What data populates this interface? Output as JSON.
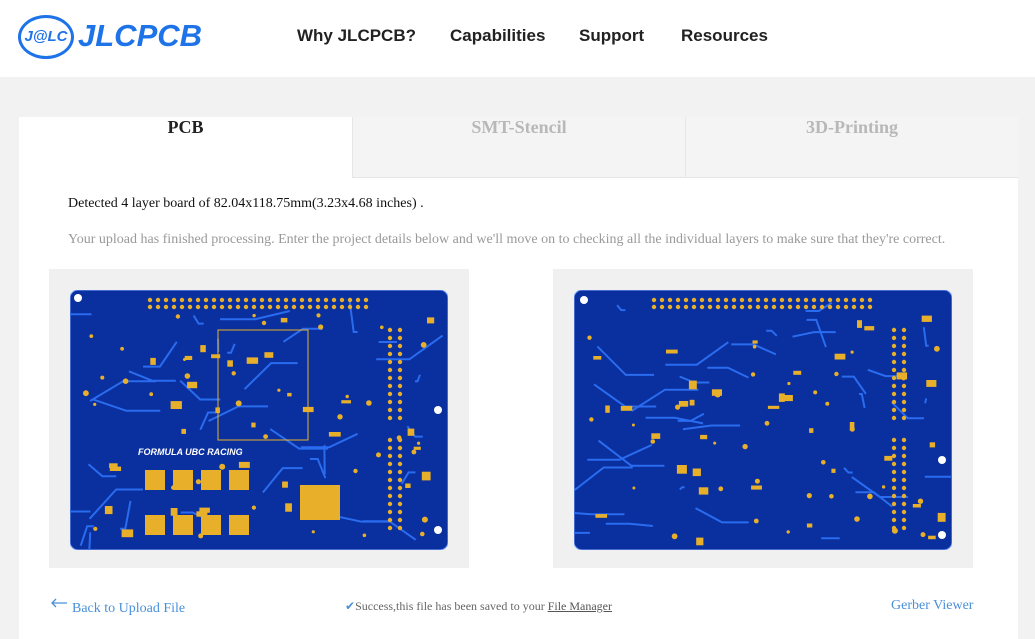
{
  "brand": {
    "badge": "J@LC",
    "name": "JLCPCB",
    "color": "#1e73e8"
  },
  "nav": [
    {
      "label": "Why JLCPCB?"
    },
    {
      "label": "Capabilities"
    },
    {
      "label": "Support"
    },
    {
      "label": "Resources"
    }
  ],
  "tabs": [
    {
      "label": "PCB",
      "active": true
    },
    {
      "label": "SMT-Stencil",
      "active": false
    },
    {
      "label": "3D-Printing",
      "active": false
    }
  ],
  "main": {
    "detected": "Detected 4 layer board of 82.04x118.75mm(3.23x4.68 inches) .",
    "info": "Your upload has finished processing. Enter the project details below and we'll move on to checking all the individual layers to make sure that they're correct.",
    "board_label": "FORMULA UBC RACING"
  },
  "footer": {
    "back": "Back to Upload File",
    "success_prefix": "Success,this file has been saved to your ",
    "file_manager": "File Manager",
    "gerber_viewer": "Gerber Viewer"
  },
  "colors": {
    "board": "#0a2f9e",
    "trace": "#1f5fe0",
    "pad": "#e8b02a",
    "accent": "#4a90d9"
  }
}
